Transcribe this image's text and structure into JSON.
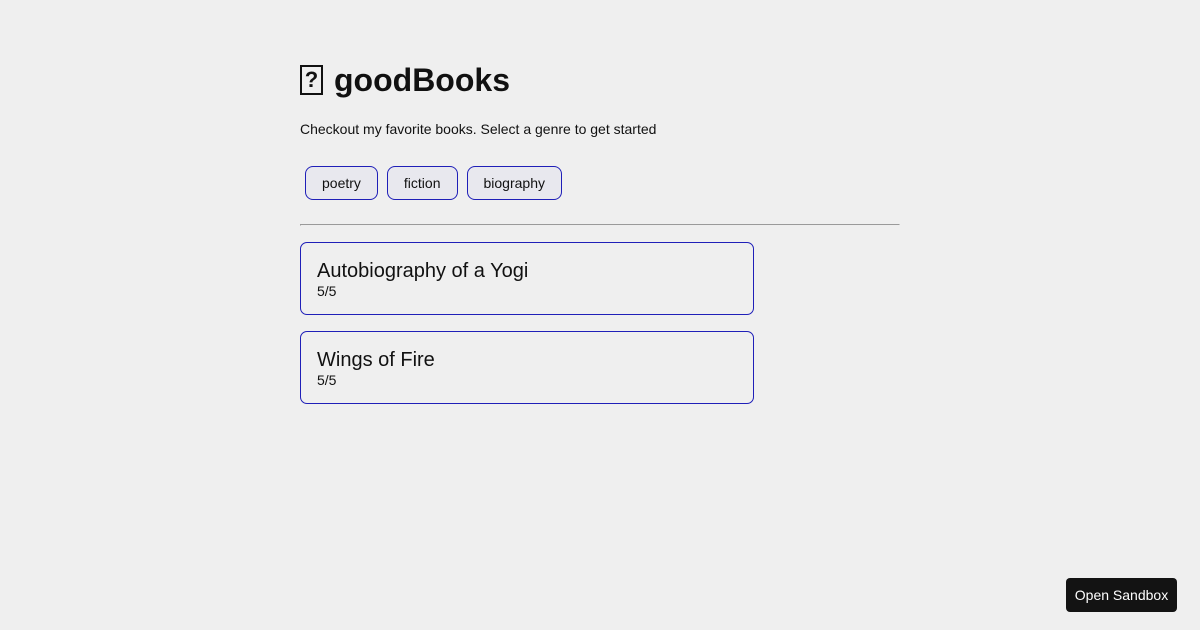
{
  "header": {
    "icon": "?",
    "title": "goodBooks",
    "subtitle": "Checkout my favorite books. Select a genre to get started"
  },
  "genres": [
    {
      "label": "poetry"
    },
    {
      "label": "fiction"
    },
    {
      "label": "biography"
    }
  ],
  "books": [
    {
      "name": "Autobiography of a Yogi",
      "rating": "5/5"
    },
    {
      "name": "Wings of Fire",
      "rating": "5/5"
    }
  ],
  "sandbox": {
    "label": "Open Sandbox"
  },
  "colors": {
    "accent_border": "#1f1fb8",
    "background": "#efefef",
    "sandbox_bg": "#131313"
  }
}
